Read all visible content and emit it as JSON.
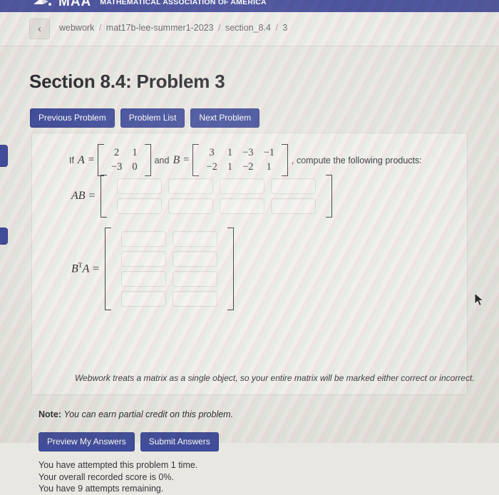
{
  "brand": {
    "logo_alt": "maa-logo",
    "short": "MAA",
    "full": "MATHEMATICAL ASSOCIATION OF AMERICA",
    "bar_color": "#4f56a0"
  },
  "breadcrumb": {
    "back_label": "‹",
    "root": "webwork",
    "course": "mat17b-lee-summer1-2023",
    "section": "section_8.4",
    "problem": "3",
    "separator": "/"
  },
  "page": {
    "title": "Section 8.4: Problem 3",
    "accent_color": "#414d9b"
  },
  "nav_buttons": {
    "previous": "Previous Problem",
    "list": "Problem List",
    "next": "Next Problem"
  },
  "problem": {
    "lead": "If",
    "var_a": "A",
    "equals": "=",
    "and": "and",
    "var_b": "B",
    "matrix_a": [
      [
        "2",
        "1"
      ],
      [
        "−3",
        "0"
      ]
    ],
    "matrix_b": [
      [
        "3",
        "1",
        "−3",
        "−1"
      ],
      [
        "−2",
        "1",
        "−2",
        "1"
      ]
    ],
    "trailing": ", compute the following products:",
    "answers": [
      {
        "name": "AB",
        "label_base": "AB",
        "label_sup": "",
        "rows": 2,
        "cols": 4,
        "values": [
          [
            "",
            "",
            "",
            ""
          ],
          [
            "",
            "",
            "",
            ""
          ]
        ]
      },
      {
        "name": "BTA",
        "label_base": "B",
        "label_sup": "T",
        "label_tail": "A",
        "rows": 4,
        "cols": 2,
        "values": [
          [
            "",
            ""
          ],
          [
            "",
            ""
          ],
          [
            "",
            ""
          ],
          [
            "",
            ""
          ]
        ]
      }
    ],
    "card_note": "Webwork treats a matrix as a single object, so your entire matrix will be marked either correct or incorrect."
  },
  "note": {
    "prefix": "Note:",
    "text": "You can earn partial credit on this problem."
  },
  "submit_buttons": {
    "preview": "Preview My Answers",
    "submit": "Submit Answers"
  },
  "status": {
    "line1": "You have attempted this problem 1 time.",
    "line2": "Your overall recorded score is 0%.",
    "line3": "You have 9 attempts remaining."
  }
}
